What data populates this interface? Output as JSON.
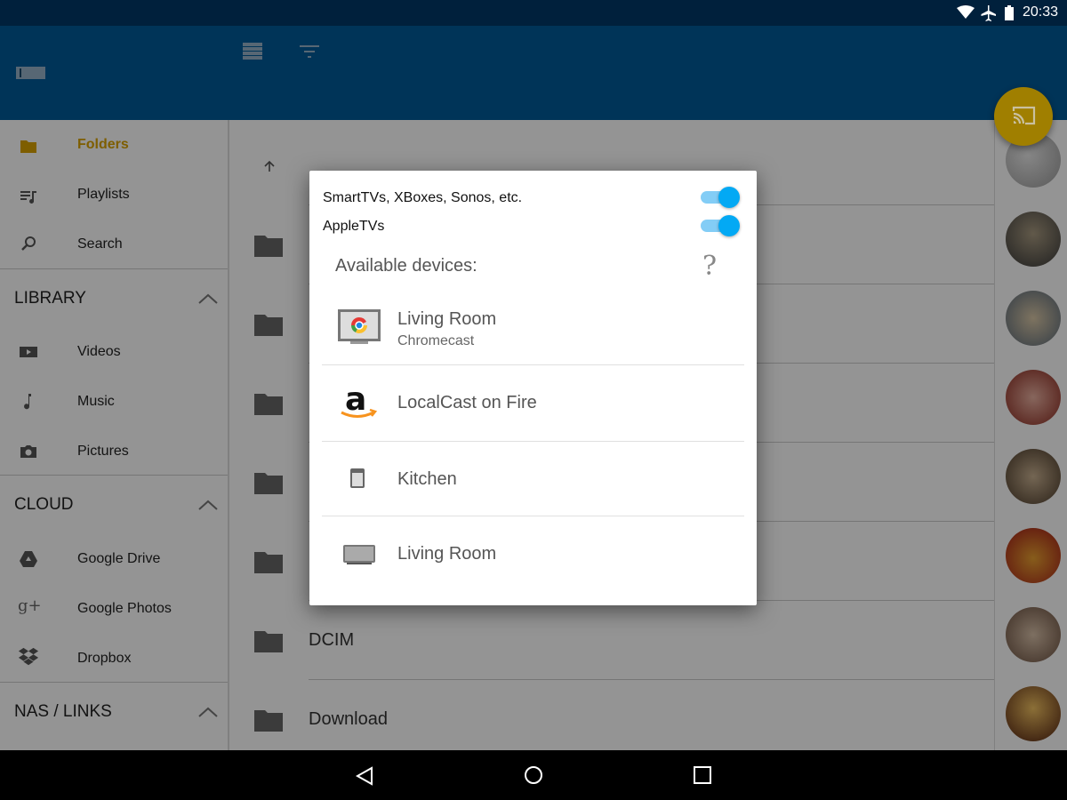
{
  "status_bar": {
    "time": "20:33"
  },
  "sidebar": {
    "top_items": [
      {
        "label": "Folders",
        "icon": "folder-icon",
        "active": true
      },
      {
        "label": "Playlists",
        "icon": "playlist-icon"
      },
      {
        "label": "Search",
        "icon": "search-icon"
      }
    ],
    "sections": [
      {
        "title": "LIBRARY",
        "items": [
          {
            "label": "Videos",
            "icon": "video-icon"
          },
          {
            "label": "Music",
            "icon": "music-note-icon"
          },
          {
            "label": "Pictures",
            "icon": "camera-icon"
          }
        ]
      },
      {
        "title": "CLOUD",
        "items": [
          {
            "label": "Google Drive",
            "icon": "google-drive-icon"
          },
          {
            "label": "Google Photos",
            "icon": "google-plus-icon"
          },
          {
            "label": "Dropbox",
            "icon": "dropbox-icon"
          }
        ]
      },
      {
        "title": "NAS / LINKS",
        "items": []
      }
    ]
  },
  "main": {
    "folders": [
      {
        "name": ""
      },
      {
        "name": ""
      },
      {
        "name": ""
      },
      {
        "name": ""
      },
      {
        "name": ""
      },
      {
        "name": "DCIM"
      },
      {
        "name": "Download"
      }
    ]
  },
  "dialog": {
    "toggles": [
      {
        "label": "SmartTVs, XBoxes, Sonos, etc.",
        "on": true
      },
      {
        "label": "AppleTVs",
        "on": true
      }
    ],
    "available_label": "Available devices:",
    "help_symbol": "?",
    "devices": [
      {
        "name": "Living Room",
        "subtitle": "Chromecast",
        "icon": "chromecast-tv-icon"
      },
      {
        "name": "LocalCast on Fire",
        "subtitle": "",
        "icon": "amazon-icon"
      },
      {
        "name": "Kitchen",
        "subtitle": "",
        "icon": "speaker-small-icon"
      },
      {
        "name": "Living Room",
        "subtitle": "",
        "icon": "speaker-wide-icon"
      }
    ]
  },
  "colors": {
    "toolbar": "#005fa0",
    "accent_active": "#d9a300",
    "toggle_on": "#03a9f4",
    "fab": "#a07f00"
  }
}
